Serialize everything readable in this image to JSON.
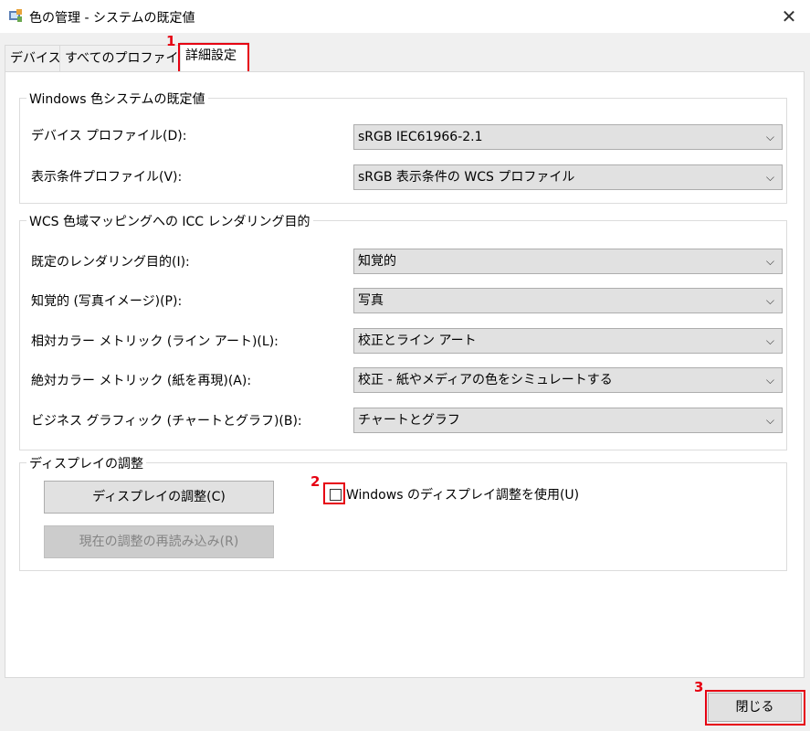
{
  "window": {
    "title": "色の管理 - システムの既定値",
    "close_glyph": "✕"
  },
  "tabs": [
    {
      "label": "デバイス"
    },
    {
      "label": "すべてのプロファイル"
    },
    {
      "label": "詳細設定"
    }
  ],
  "annotations": {
    "tab": "1",
    "checkbox": "2",
    "close": "3",
    "color": "#e60012"
  },
  "wcs_defaults": {
    "title": "Windows 色システムの既定値",
    "device_profile_label": "デバイス プロファイル(D):",
    "device_profile_value": "sRGB IEC61966-2.1",
    "viewing_profile_label": "表示条件プロファイル(V):",
    "viewing_profile_value": "sRGB 表示条件の WCS プロファイル"
  },
  "rendering": {
    "title": "WCS 色域マッピングへの ICC レンダリング目的",
    "rows": [
      {
        "label": "既定のレンダリング目的(I):",
        "value": "知覚的"
      },
      {
        "label": "知覚的 (写真イメージ)(P):",
        "value": "写真"
      },
      {
        "label": "相対カラー メトリック (ライン アート)(L):",
        "value": "校正とライン アート"
      },
      {
        "label": "絶対カラー メトリック (紙を再現)(A):",
        "value": "校正 - 紙やメディアの色をシミュレートする"
      },
      {
        "label": "ビジネス グラフィック (チャートとグラフ)(B):",
        "value": "チャートとグラフ"
      }
    ]
  },
  "calibration": {
    "title": "ディスプレイの調整",
    "calibrate_button": "ディスプレイの調整(C)",
    "reload_button": "現在の調整の再読み込み(R)",
    "checkbox_label": "Windows のディスプレイ調整を使用(U)",
    "checkbox_checked": false
  },
  "footer": {
    "close_button": "閉じる"
  },
  "icons": {
    "chevron": "chevron-down-icon",
    "close": "close-icon",
    "app": "color-management-icon"
  }
}
